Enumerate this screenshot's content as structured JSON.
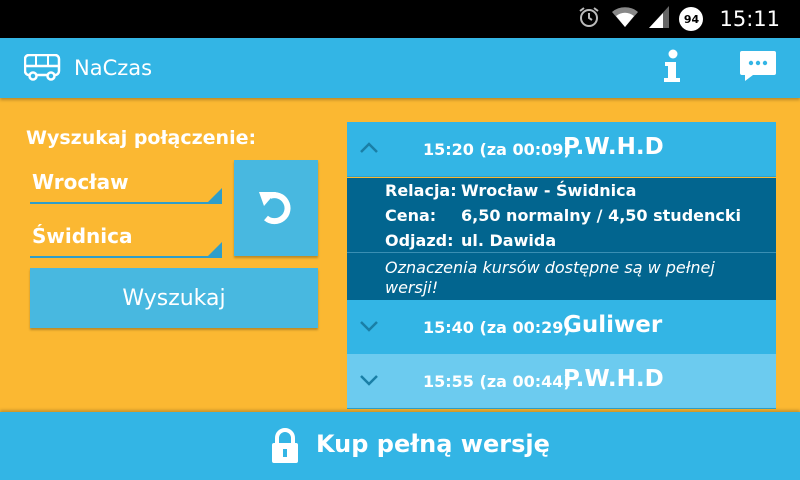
{
  "status": {
    "time": "15:11",
    "battery": "94"
  },
  "app": {
    "title": "NaCzas"
  },
  "search": {
    "label": "Wyszukaj połączenie:",
    "from": "Wrocław",
    "to": "Świdnica",
    "button": "Wyszukaj"
  },
  "results": [
    {
      "time": "15:20 (za 00:09)",
      "name": "P.W.H.D",
      "expanded": true
    },
    {
      "time": "15:40 (za 00:29)",
      "name": "Guliwer",
      "expanded": false
    },
    {
      "time": "15:55 (za 00:44)",
      "name": "P.W.H.D",
      "expanded": false
    }
  ],
  "details": {
    "relation_label": "Relacja:",
    "relation": "Wrocław - Świdnica",
    "price_label": "Cena:",
    "price": "6,50 normalny / 4,50 studencki",
    "departure_label": "Odjazd:",
    "departure": "ul. Dawida",
    "note": "Oznaczenia kursów dostępne są w pełnej wersji!"
  },
  "buy": {
    "label": "Kup pełną wersję"
  },
  "colors": {
    "background": "#fbb832",
    "accent": "#33b5e5",
    "detail_bg": "#02658f",
    "button_bg": "#48b8e0"
  }
}
